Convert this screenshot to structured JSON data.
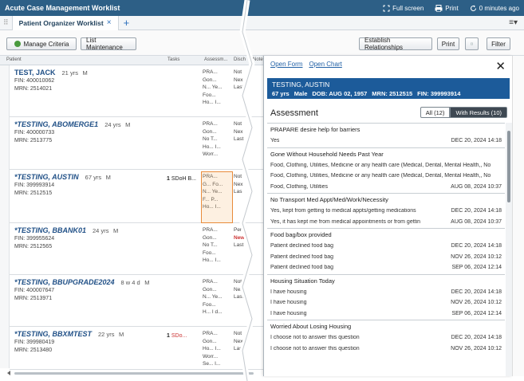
{
  "titlebar": {
    "title": "Acute Case Management Worklist",
    "fullscreen": "Full screen",
    "print": "Print",
    "refresh": "0 minutes ago"
  },
  "tabbar": {
    "tab_label": "Patient Organizer Worklist",
    "close": "×",
    "plus": "+",
    "menu": "≡▾",
    "drag": "⠿"
  },
  "toolbar": {
    "manage_criteria": "Manage Criteria",
    "list_maintenance": "List Maintenance",
    "establish_relationships": "Establish Relationships",
    "print": "Print",
    "filter": "Filter"
  },
  "grid": {
    "columns": {
      "patient": "Patient",
      "tasks": "Tasks",
      "assessment": "Assessm...",
      "disch": "Disch",
      "notes": "Note"
    },
    "rows": [
      {
        "name": "TEST, JACK",
        "age": "21 yrs",
        "sex": "M",
        "l2": "FIN: 400010062",
        "l3": "MRN: 2514021",
        "tasks": "",
        "tasks_extra": "",
        "assess": [
          "PRA...",
          "Gon...",
          "N... Ye...",
          "Foo...",
          "Ho... I..."
        ],
        "disch": [
          "Not",
          "Nex",
          "Last",
          "",
          ""
        ]
      },
      {
        "name": "*TESTING, ABOMERGE1",
        "age": "24 yrs",
        "sex": "M",
        "l2": "FIN: 400000733",
        "l3": "MRN: 2513775",
        "tasks": "",
        "tasks_extra": "",
        "assess": [
          "PRA...",
          "Gon...",
          "No T...",
          "Ho... I...",
          "Worr..."
        ],
        "disch": [
          "Not",
          "Nex",
          "Last",
          "",
          ""
        ]
      },
      {
        "name": "*TESTING, AUSTIN",
        "age": "67 yrs",
        "sex": "M",
        "l2": "FIN: 399993914",
        "l3": "MRN: 2512515",
        "tasks": "1",
        "tasks_extra": "SDoH B...",
        "assess": [
          "PRA...",
          "G... Fo...",
          "N... Ye...",
          "F... P...",
          "Ho... I..."
        ],
        "disch": [
          "Not",
          "Nex",
          "Las",
          "",
          ""
        ]
      },
      {
        "name": "*TESTING, BBANK01",
        "age": "24 yrs",
        "sex": "M",
        "l2": "FIN: 399955624",
        "l3": "MRN: 2512565",
        "tasks": "",
        "tasks_extra": "",
        "assess": [
          "PRA...",
          "Gon...",
          "No T...",
          "Foo...",
          "Ho... I..."
        ],
        "disch": [
          "Pen",
          "New",
          "Last",
          "",
          ""
        ]
      },
      {
        "name": "*TESTING, BBUPGRADE2024",
        "age": "8 w 4 d",
        "sex": "M",
        "l2": "FIN: 400007647",
        "l3": "MRN: 2513971",
        "tasks": "",
        "tasks_extra": "",
        "assess": [
          "PRA...",
          "Gon...",
          "N... Ye...",
          "Foo...",
          "H... I d..."
        ],
        "disch": [
          "Not",
          "Nex",
          "Last",
          "",
          ""
        ]
      },
      {
        "name": "*TESTING, BBXMTEST",
        "age": "22 yrs",
        "sex": "M",
        "l2": "FIN: 399980419",
        "l3": "MRN: 2513480",
        "tasks": "1",
        "tasks_extra": "SDo...",
        "assess": [
          "PRA...",
          "Gon...",
          "Ho... I...",
          "Worr...",
          "Se... I..."
        ],
        "disch": [
          "Not",
          "Nex",
          "Last",
          "",
          ""
        ]
      }
    ]
  },
  "panel": {
    "open_form": "Open Form",
    "open_chart": "Open Chart",
    "close": "✕",
    "patient_name": "TESTING, AUSTIN",
    "age": "67 yrs",
    "sex": "Male",
    "dob": "DOB: AUG 02, 1957",
    "mrn": "MRN: 2512515",
    "fin": "FIN: 399993914",
    "heading": "Assessment",
    "all_btn": "All (12)",
    "results_btn": "With Results (10)",
    "sections": [
      {
        "title": "PRAPARE desire help for barriers",
        "rows": [
          {
            "value": "Yes",
            "time": "DEC 20, 2024 14:18"
          }
        ]
      },
      {
        "title": "Gone Without Household Needs Past Year",
        "rows": [
          {
            "value": "Food, Clothing, Utilities, Medicine or any health care (Medical, Dental, Mental Health,, No",
            "time": ""
          },
          {
            "value": "Food, Clothing, Utilities, Medicine or any health care (Medical, Dental, Mental Health,, No",
            "time": ""
          },
          {
            "value": "Food, Clothing, Utilities",
            "time": "AUG 08, 2024 10:37"
          }
        ]
      },
      {
        "title": "No Transport Med Appt/Med/Work/Necessity",
        "rows": [
          {
            "value": "Yes, kept from getting to medical appts/getting medications",
            "time": "DEC 20, 2024 14:18"
          },
          {
            "value": "Yes, it has kept me from medical appointments or from gettin",
            "time": "AUG 08, 2024 10:37"
          }
        ]
      },
      {
        "title": "Food bag/box provided",
        "rows": [
          {
            "value": "Patient declined food bag",
            "time": "DEC 20, 2024 14:18"
          },
          {
            "value": "Patient declined food bag",
            "time": "NOV 26, 2024 10:12"
          },
          {
            "value": "Patient declined food bag",
            "time": "SEP 06, 2024 12:14"
          }
        ]
      },
      {
        "title": "Housing Situation Today",
        "rows": [
          {
            "value": "I have housing",
            "time": "DEC 20, 2024 14:18"
          },
          {
            "value": "I have housing",
            "time": "NOV 26, 2024 10:12"
          },
          {
            "value": "I have housing",
            "time": "SEP 06, 2024 12:14"
          }
        ]
      },
      {
        "title": "Worried About Losing Housing",
        "rows": [
          {
            "value": "I choose not to answer this question",
            "time": "DEC 20, 2024 14:18"
          },
          {
            "value": "I choose not to answer this question",
            "time": "NOV 26, 2024 10:12"
          }
        ]
      }
    ]
  },
  "colors": {
    "titlebar": "#2d5f86",
    "banner": "#1c5b9a",
    "link": "#1f5fa5",
    "highlight": "#e88b3a"
  }
}
